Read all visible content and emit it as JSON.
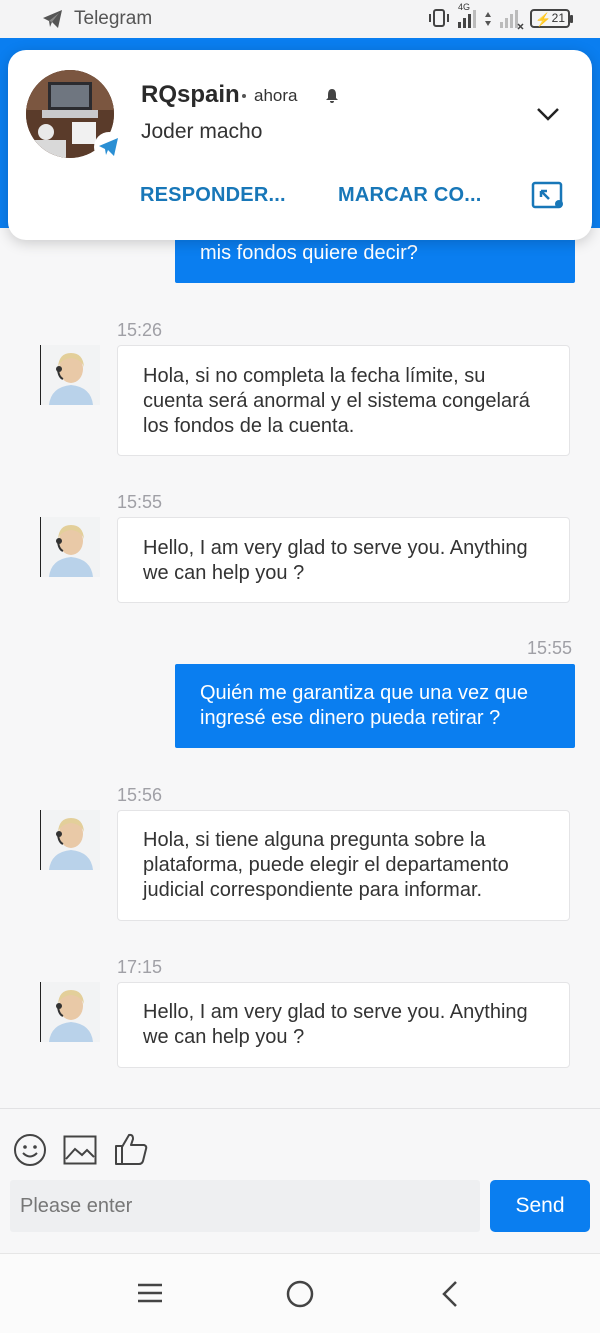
{
  "status_bar": {
    "app_name": "Telegram",
    "network": "4G",
    "battery": "21",
    "icons": [
      "telegram-icon",
      "vibrate-icon",
      "signal-icon",
      "data-arrows-icon",
      "signal-icon-2",
      "battery-icon"
    ]
  },
  "notification": {
    "sender": "RQspain",
    "time": "ahora",
    "message": "Joder macho",
    "actions": [
      "RESPONDER...",
      "MARCAR CO..."
    ],
    "icons": [
      "bell-icon",
      "chevron-down-icon",
      "telegram-badge-icon",
      "picture-in-picture-icon"
    ]
  },
  "messages": [
    {
      "direction": "out",
      "time": "",
      "text": "mis fondos quiere decir?"
    },
    {
      "direction": "in",
      "time": "15:26",
      "text": "Hola, si no completa la fecha límite, su cuenta será anormal y el sistema congelará los fondos de la cuenta."
    },
    {
      "direction": "in",
      "time": "15:55",
      "text": "Hello, I am very glad to serve you. Anything we can help you ?"
    },
    {
      "direction": "out",
      "time": "15:55",
      "text": "Quién me garantiza que una vez que ingresé ese dinero pueda retirar ?"
    },
    {
      "direction": "in",
      "time": "15:56",
      "text": "Hola, si tiene alguna pregunta sobre la plataforma, puede elegir el departamento judicial correspondiente para informar."
    },
    {
      "direction": "in",
      "time": "17:15",
      "text": "Hello, I am very glad to serve you. Anything we can help you ?"
    }
  ],
  "composer": {
    "placeholder": "Please enter",
    "value": "",
    "send_label": "Send",
    "tools": [
      "smiley-icon",
      "image-icon",
      "thumbs-up-icon"
    ]
  },
  "nav_bar": {
    "buttons": [
      "menu-icon",
      "home-icon",
      "back-icon"
    ]
  },
  "colors": {
    "accent": "#0a7ef0",
    "notification_action": "#1877b8",
    "timestamp": "#a0a0a6"
  }
}
